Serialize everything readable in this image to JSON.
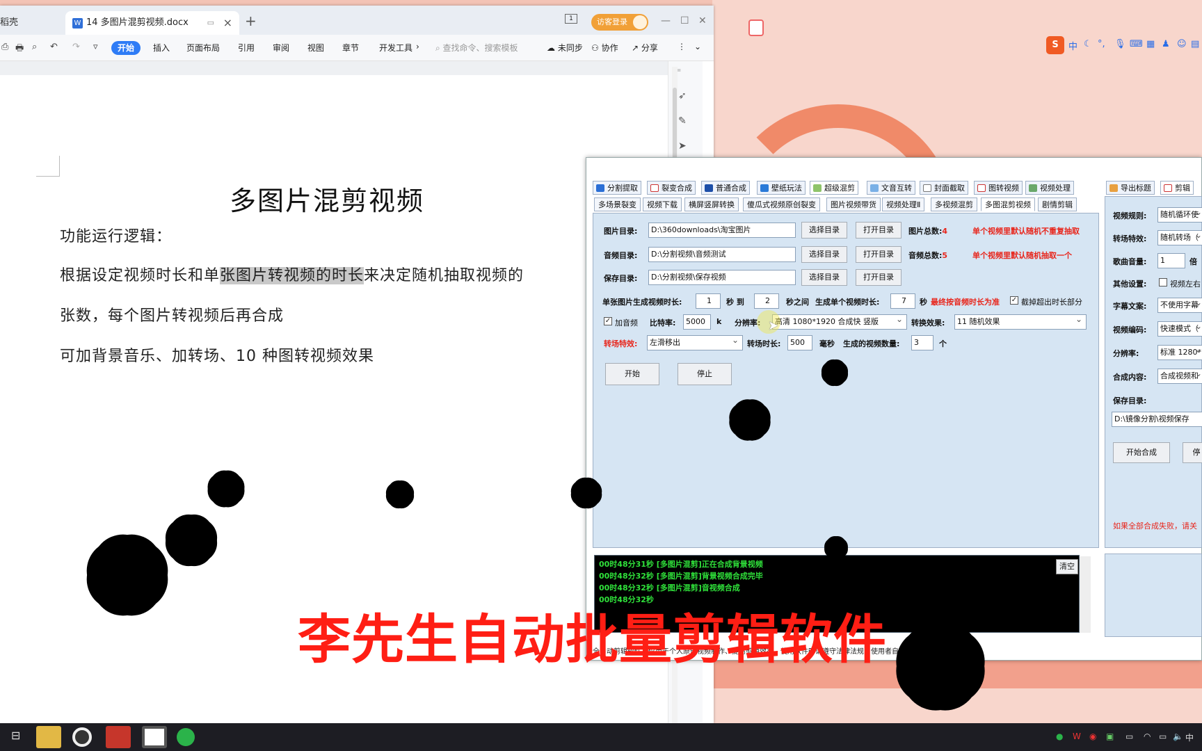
{
  "wps": {
    "home_tab": "稻壳",
    "doc_tab": "14 多图片混剪视频.docx",
    "new_tab": "+",
    "login": "访客登录",
    "page_indicator": "1",
    "ribbon": [
      "开始",
      "插入",
      "页面布局",
      "引用",
      "审阅",
      "视图",
      "章节",
      "开发工具"
    ],
    "search_placeholder": "查找命令、搜索模板",
    "unsync": "未同步",
    "collab": "协作",
    "share": "分享",
    "doc_title": "多图片混剪视频",
    "para1": "功能运行逻辑：",
    "para2a": "根据设定视频时长和单",
    "para2b": "张图片转视频的时长",
    "para2c": "来决定随机抽取视频的",
    "para3": "张数，每个图片转视频后再合成",
    "para4": "可加背景音乐、加转场、10 种图转视频效果"
  },
  "app": {
    "main_tabs": [
      "分割提取",
      "裂变合成",
      "普通合成",
      "壁纸玩法",
      "超级混剪",
      "文音互转",
      "封面截取",
      "图转视频",
      "视频处理"
    ],
    "right_tabs": [
      "导出标题",
      "剪辑"
    ],
    "sub_tabs": [
      "多场景裂变",
      "视频下载",
      "横屏竖屏转换",
      "傻瓜式视频原创裂变",
      "图片视频带货",
      "视频处理Ⅱ",
      "多视频混剪",
      "多图混剪视频",
      "剧情剪辑"
    ],
    "img_dir_label": "图片目录:",
    "img_dir": "D:\\360downloads\\淘宝图片",
    "audio_dir_label": "音频目录:",
    "audio_dir": "D:\\分割视频\\音频测试",
    "save_dir_label": "保存目录:",
    "save_dir": "D:\\分割视频\\保存视频",
    "choose_dir": "选择目录",
    "open_dir": "打开目录",
    "img_total_label": "图片总数:",
    "img_total": "4",
    "audio_total_label": "音频总数:",
    "audio_total": "5",
    "note1": "单个视频里默认随机不重复抽取",
    "note2": "单个视频里默认随机抽取一个",
    "single_dur_label": "单张图片生成视频时长:",
    "single_from": "1",
    "sec_to": "秒 到",
    "single_to": "2",
    "sec_between": "秒之间",
    "gen_dur_label": "生成单个视频时长:",
    "gen_dur": "7",
    "sec": "秒",
    "audio_note": "最终按音频时长为准",
    "trim_label": "截掉超出时长部分",
    "add_audio": "加音频",
    "bitrate_label": "比特率:",
    "bitrate": "5000",
    "k": "k",
    "res_label": "分辨率:",
    "res": "高清 1080*1920 合成快 竖版",
    "effect_label": "转换效果:",
    "effect": "11 随机效果",
    "trans_label": "转场特效:",
    "trans": "左滑移出",
    "trans_dur_label": "转场时长:",
    "trans_dur": "500",
    "ms": "毫秒",
    "count_label": "生成的视频数量:",
    "count": "3",
    "unit": "个",
    "start": "开始",
    "stop": "停止",
    "log": [
      "00时48分31秒 [多图片混剪]正在合成背景视频",
      "00时48分32秒 [多图片混剪]背景视频合成完毕",
      "00时48分32秒 [多图片混剪]音视频合成",
      "00时48分32秒"
    ],
    "clear": "清空",
    "footer": "全自动剪辑软件，仅用于个人原创视频制作、提高剪辑效率，使用软件时请遵守法律法规，使用者自行承担全部责任!",
    "right": {
      "rule_label": "视频规则:",
      "rule": "随机循环使",
      "fx_label": "转场特效:",
      "fx": "随机转场（",
      "vol_label": "歌曲音量:",
      "vol": "1",
      "vol_unit": "倍",
      "other_label": "其他设置:",
      "other": "视频左右",
      "sub_label": "字幕文案:",
      "sub": "不使用字幕",
      "enc_label": "视频编码:",
      "enc": "快速模式（",
      "res_label": "分辨率:",
      "res": "标准 1280*",
      "content_label": "合成内容:",
      "content": "合成视频和",
      "save_label": "保存目录:",
      "save": "D:\\镜像分割\\视频保存",
      "start": "开始合成",
      "stop": "停",
      "warn": "如果全部合成失败，请关"
    }
  },
  "caption": "李先生自动批量剪辑软件",
  "ime": "中",
  "tray": {
    "lang": "中"
  },
  "colors": {
    "accent": "#2e7cf6",
    "caption": "#ff1e14",
    "panel": "#d6e5f3"
  }
}
